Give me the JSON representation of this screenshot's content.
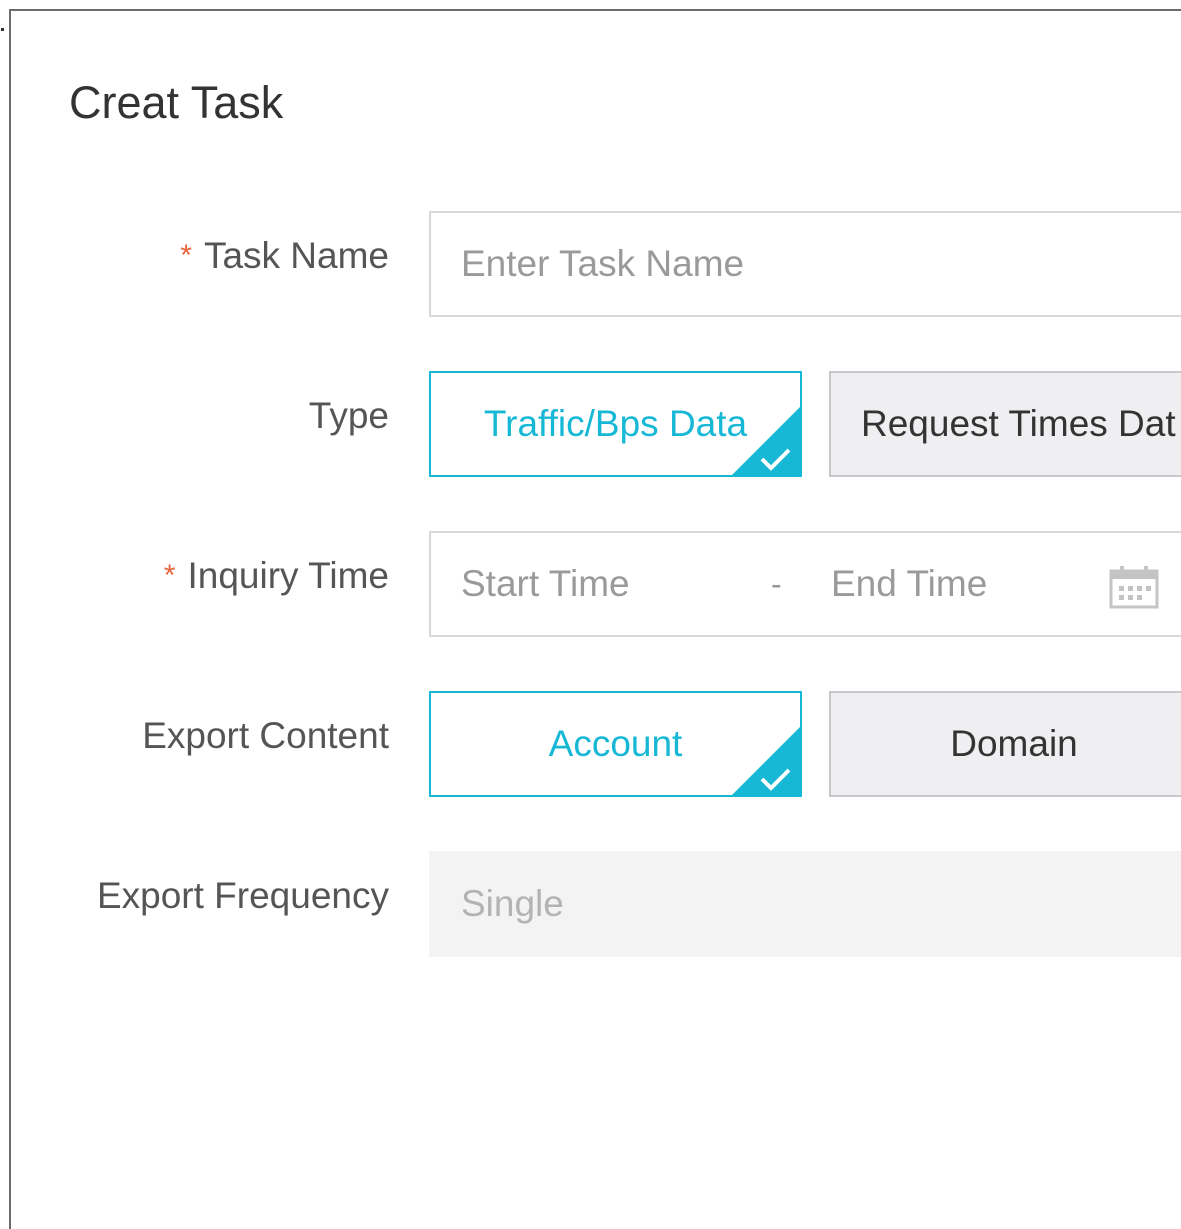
{
  "dialog": {
    "title": "Creat Task"
  },
  "form": {
    "task_name": {
      "label": "Task Name",
      "required": true,
      "required_mark": "*",
      "placeholder": "Enter Task Name",
      "value": ""
    },
    "type": {
      "label": "Type",
      "options": [
        {
          "label": "Traffic/Bps Data",
          "selected": true
        },
        {
          "label": "Request Times Dat",
          "selected": false
        }
      ]
    },
    "inquiry_time": {
      "label": "Inquiry Time",
      "required": true,
      "required_mark": "*",
      "start_placeholder": "Start Time",
      "separator": "-",
      "end_placeholder": "End Time",
      "icon": "calendar-icon"
    },
    "export_content": {
      "label": "Export Content",
      "options": [
        {
          "label": "Account",
          "selected": true
        },
        {
          "label": "Domain",
          "selected": false
        }
      ]
    },
    "export_frequency": {
      "label": "Export Frequency",
      "value": "Single",
      "disabled": true
    }
  },
  "colors": {
    "accent": "#16b8d6",
    "required": "#e8643c",
    "border": "#d7d8d9",
    "unselected_bg": "#efeff2",
    "disabled_bg": "#f3f3f3"
  }
}
